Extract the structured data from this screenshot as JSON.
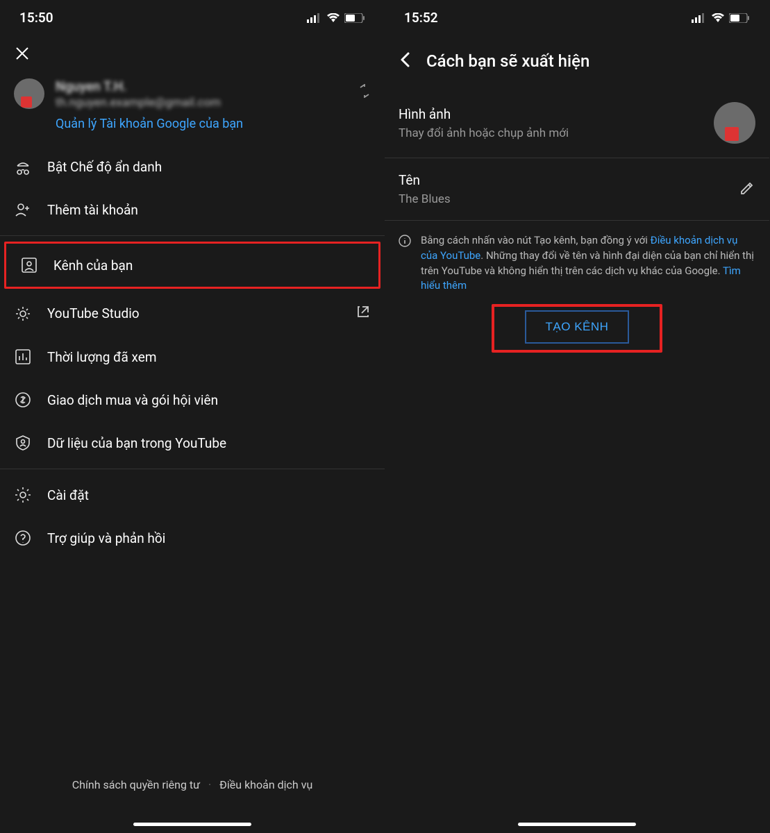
{
  "statusBar": {
    "time1": "15:50",
    "time2": "15:52"
  },
  "screen1": {
    "account": {
      "name": "Nguyen T.H.",
      "email": "th.nguyen.example@gmail.com",
      "manageLink": "Quản lý Tài khoản Google của bạn"
    },
    "items": {
      "incognito": "Bật Chế độ ẩn danh",
      "addAccount": "Thêm tài khoản",
      "yourChannel": "Kênh của bạn",
      "studio": "YouTube Studio",
      "timeWatched": "Thời lượng đã xem",
      "purchases": "Giao dịch mua và gói hội viên",
      "yourData": "Dữ liệu của bạn trong YouTube",
      "settings": "Cài đặt",
      "help": "Trợ giúp và phản hồi"
    },
    "footer": {
      "privacy": "Chính sách quyền riêng tư",
      "terms": "Điều khoản dịch vụ"
    }
  },
  "screen2": {
    "title": "Cách bạn sẽ xuất hiện",
    "sections": {
      "image": {
        "title": "Hình ảnh",
        "sub": "Thay đổi ảnh hoặc chụp ảnh mới"
      },
      "name": {
        "title": "Tên",
        "value": "The Blues"
      }
    },
    "info": {
      "pre": "Bằng cách nhấn vào nút Tạo kênh, bạn đồng ý với ",
      "link1": "Điều khoản dịch vụ của YouTube",
      "mid": ". Những thay đổi về tên và hình đại diện của bạn chỉ hiển thị trên YouTube và không hiển thị trên các dịch vụ khác của Google. ",
      "link2": "Tìm hiểu thêm"
    },
    "createBtn": "TẠO KÊNH"
  }
}
